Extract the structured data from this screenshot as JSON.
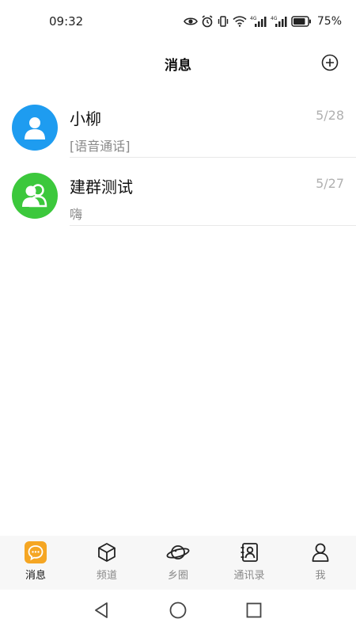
{
  "status_bar": {
    "time": "09:32",
    "battery_percent": "75%",
    "icons": [
      "eye-icon",
      "alarm-icon",
      "vibrate-icon",
      "wifi-icon",
      "signal-4g-icon",
      "signal-4g-icon",
      "battery-icon"
    ]
  },
  "header": {
    "title": "消息",
    "add_icon": "plus-circle-icon"
  },
  "chats": [
    {
      "name": "小柳",
      "preview": "[语音通话]",
      "date": "5/28",
      "avatar_color": "#1e9cf0",
      "avatar_icon": "person-icon"
    },
    {
      "name": "建群测试",
      "preview": "嗨",
      "date": "5/27",
      "avatar_color": "#3cc83c",
      "avatar_icon": "group-icon"
    }
  ],
  "tabs": [
    {
      "label": "消息",
      "icon": "message-icon",
      "active": true
    },
    {
      "label": "频道",
      "icon": "cube-icon",
      "active": false
    },
    {
      "label": "乡圈",
      "icon": "planet-icon",
      "active": false
    },
    {
      "label": "通讯录",
      "icon": "contacts-icon",
      "active": false
    },
    {
      "label": "我",
      "icon": "profile-icon",
      "active": false
    }
  ],
  "colors": {
    "accent": "#f5a623",
    "person_avatar": "#1e9cf0",
    "group_avatar": "#3cc83c"
  },
  "nav_bar": {
    "icons": [
      "back-icon",
      "home-icon",
      "recents-icon"
    ]
  }
}
